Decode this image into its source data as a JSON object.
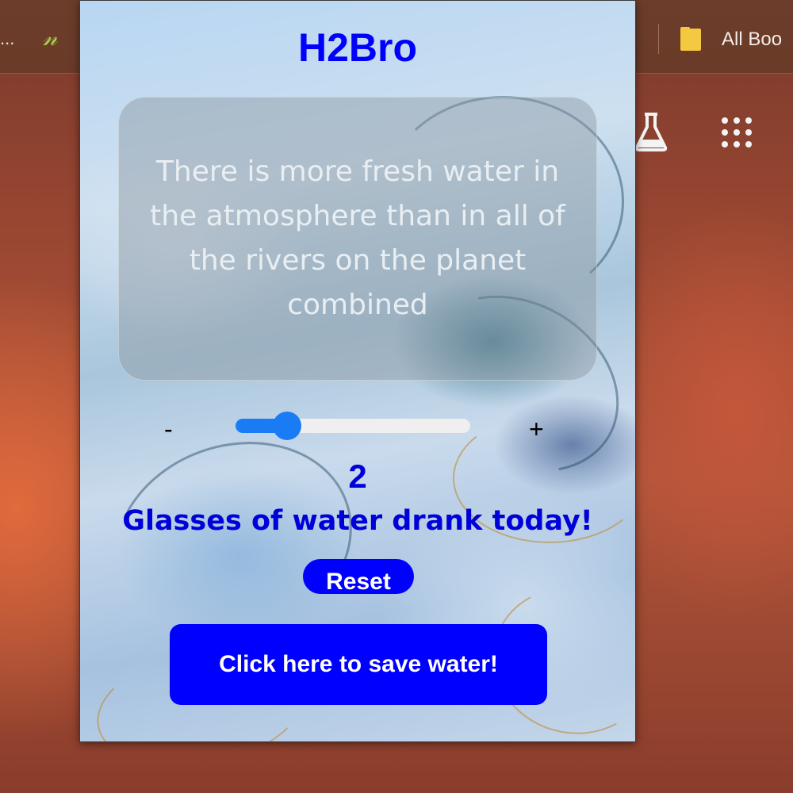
{
  "browser": {
    "truncated_left": "...",
    "bookmark_icon_glyph": "𝓃",
    "bookmarks_label": "All Boo",
    "icons": [
      "n-logo-icon",
      "folder-icon",
      "flask-icon",
      "apps-grid-icon"
    ]
  },
  "popup": {
    "title": "H2Bro",
    "fact": "There is more fresh water in the atmosphere than in all of the rivers on the planet combined",
    "decrement_label": "-",
    "increment_label": "+",
    "slider": {
      "value": 2,
      "level": 0.22
    },
    "count": "2",
    "count_label": "Glasses of water drank today!",
    "reset_label": "Reset",
    "save_label": "Click here to save water!"
  },
  "colors": {
    "accent": "#0000ff",
    "slider": "#1a7cf5",
    "text_blue": "#0000d8"
  }
}
